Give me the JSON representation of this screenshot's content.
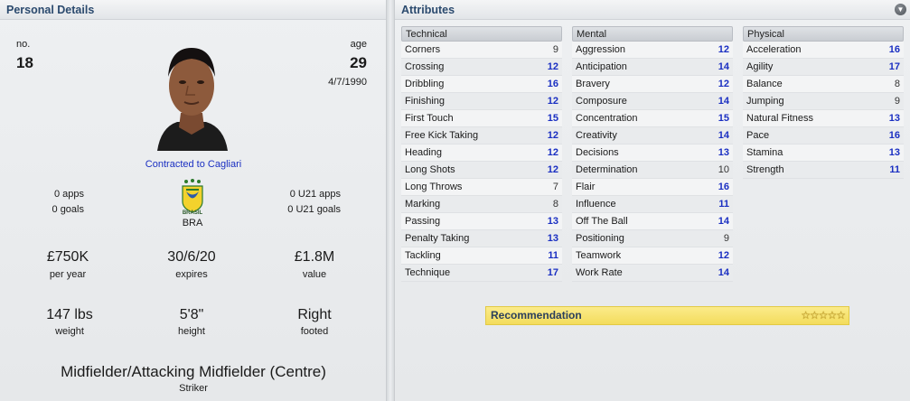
{
  "personal": {
    "header": "Personal Details",
    "number_label": "no.",
    "number": "18",
    "age_label": "age",
    "age": "29",
    "dob": "4/7/1990",
    "contract": "Contracted to Cagliari",
    "apps": "0 apps",
    "goals": "0 goals",
    "nation_badge_text": "BRASIL",
    "nation_code": "BRA",
    "u21_apps": "0 U21 apps",
    "u21_goals": "0 U21 goals",
    "wage": "£750K",
    "wage_label": "per year",
    "expires": "30/6/20",
    "expires_label": "expires",
    "value": "£1.8M",
    "value_label": "value",
    "weight": "147 lbs",
    "weight_label": "weight",
    "height": "5'8\"",
    "height_label": "height",
    "foot": "Right",
    "foot_label": "footed",
    "position": "Midfielder/Attacking Midfielder (Centre)",
    "secondary_position": "Striker"
  },
  "attributes": {
    "header": "Attributes",
    "highlight_color": "#1a2fc2",
    "technical": {
      "title": "Technical",
      "rows": [
        {
          "name": "Corners",
          "value": "9"
        },
        {
          "name": "Crossing",
          "value": "12"
        },
        {
          "name": "Dribbling",
          "value": "16"
        },
        {
          "name": "Finishing",
          "value": "12"
        },
        {
          "name": "First Touch",
          "value": "15"
        },
        {
          "name": "Free Kick Taking",
          "value": "12"
        },
        {
          "name": "Heading",
          "value": "12"
        },
        {
          "name": "Long Shots",
          "value": "12"
        },
        {
          "name": "Long Throws",
          "value": "7"
        },
        {
          "name": "Marking",
          "value": "8"
        },
        {
          "name": "Passing",
          "value": "13"
        },
        {
          "name": "Penalty Taking",
          "value": "13"
        },
        {
          "name": "Tackling",
          "value": "11"
        },
        {
          "name": "Technique",
          "value": "17"
        }
      ]
    },
    "mental": {
      "title": "Mental",
      "rows": [
        {
          "name": "Aggression",
          "value": "12"
        },
        {
          "name": "Anticipation",
          "value": "14"
        },
        {
          "name": "Bravery",
          "value": "12"
        },
        {
          "name": "Composure",
          "value": "14"
        },
        {
          "name": "Concentration",
          "value": "15"
        },
        {
          "name": "Creativity",
          "value": "14"
        },
        {
          "name": "Decisions",
          "value": "13"
        },
        {
          "name": "Determination",
          "value": "10"
        },
        {
          "name": "Flair",
          "value": "16"
        },
        {
          "name": "Influence",
          "value": "11"
        },
        {
          "name": "Off The Ball",
          "value": "14"
        },
        {
          "name": "Positioning",
          "value": "9"
        },
        {
          "name": "Teamwork",
          "value": "12"
        },
        {
          "name": "Work Rate",
          "value": "14"
        }
      ]
    },
    "physical": {
      "title": "Physical",
      "rows": [
        {
          "name": "Acceleration",
          "value": "16"
        },
        {
          "name": "Agility",
          "value": "17"
        },
        {
          "name": "Balance",
          "value": "8"
        },
        {
          "name": "Jumping",
          "value": "9"
        },
        {
          "name": "Natural Fitness",
          "value": "13"
        },
        {
          "name": "Pace",
          "value": "16"
        },
        {
          "name": "Stamina",
          "value": "13"
        },
        {
          "name": "Strength",
          "value": "11"
        }
      ]
    },
    "recommendation_label": "Recommendation",
    "recommendation_stars": "☆☆☆☆☆"
  }
}
